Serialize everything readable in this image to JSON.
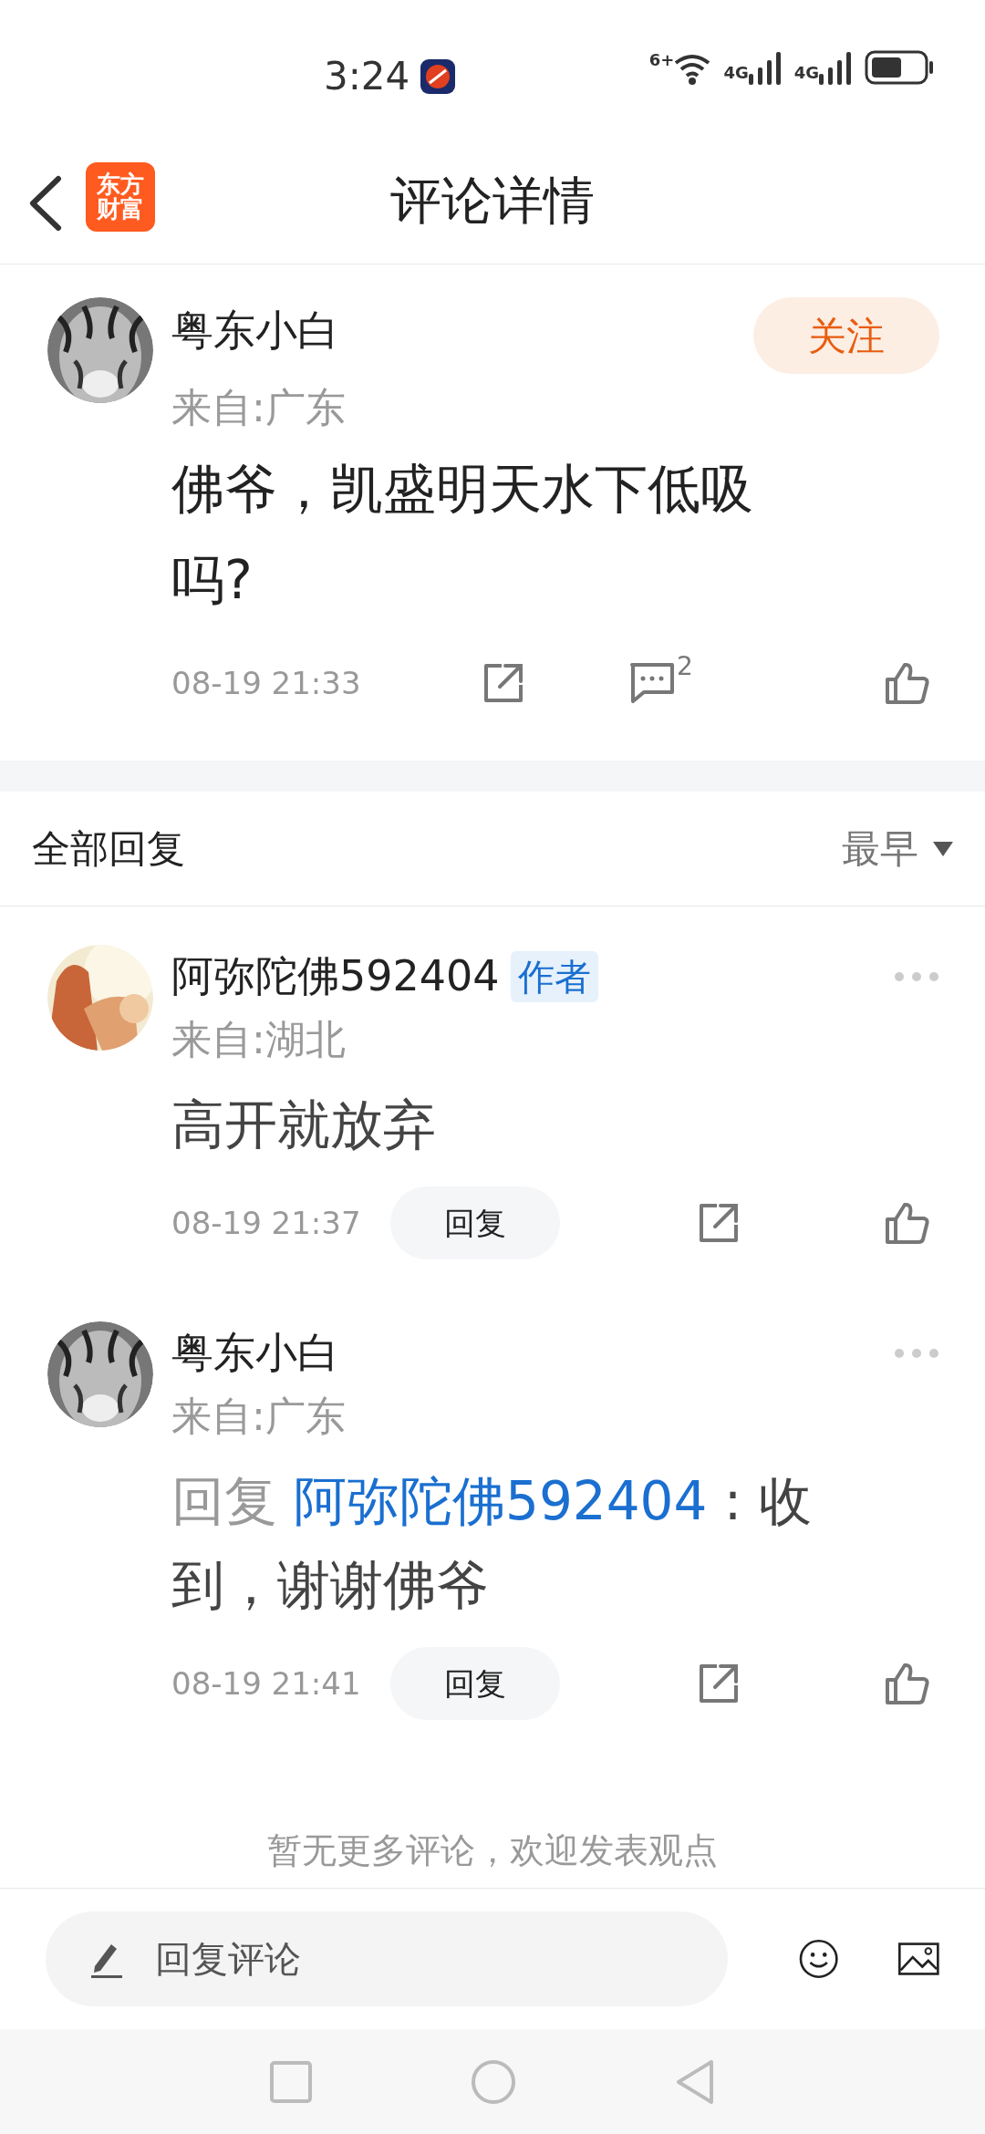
{
  "status_bar": {
    "time": "3:24",
    "wifi_badge": "6+",
    "signal_labels": [
      "4G",
      "4G"
    ]
  },
  "header": {
    "logo_lines": [
      "东方",
      "财富"
    ],
    "title": "评论详情"
  },
  "main_comment": {
    "author": "粤东小白",
    "location": "来自:广东",
    "follow_label": "关注",
    "content": "佛爷，凯盛明天水下低吸吗?",
    "time": "08-19 21:33",
    "comment_count": "2"
  },
  "replies_header": {
    "title": "全部回复",
    "sort": "最早"
  },
  "replies": [
    {
      "author": "阿弥陀佛592404",
      "badge": "作者",
      "location": "来自:湖北",
      "content": "高开就放弃",
      "time": "08-19 21:37",
      "reply_label": "回复"
    },
    {
      "author": "粤东小白",
      "location": "来自:广东",
      "reply_prefix": "回复",
      "reply_to": "阿弥陀佛592404",
      "content": " : 收到，谢谢佛爷",
      "time": "08-19 21:41",
      "reply_label": "回复"
    }
  ],
  "end_note": "暂无更多评论，欢迎发表观点",
  "composer": {
    "placeholder": "回复评论"
  }
}
